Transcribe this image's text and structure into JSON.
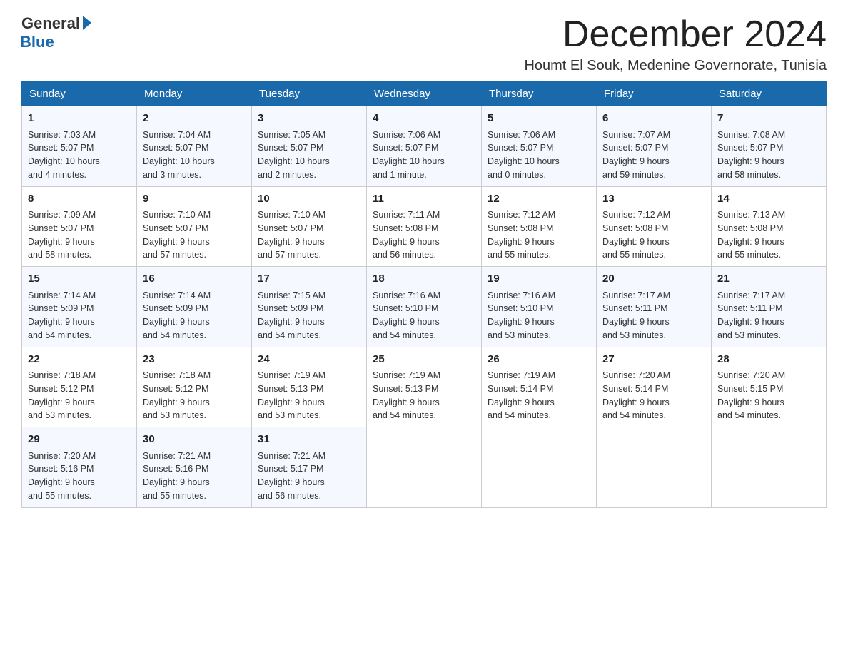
{
  "logo": {
    "general": "General",
    "blue": "Blue"
  },
  "header": {
    "month_year": "December 2024",
    "location": "Houmt El Souk, Medenine Governorate, Tunisia"
  },
  "columns": [
    "Sunday",
    "Monday",
    "Tuesday",
    "Wednesday",
    "Thursday",
    "Friday",
    "Saturday"
  ],
  "weeks": [
    [
      {
        "day": "1",
        "info": "Sunrise: 7:03 AM\nSunset: 5:07 PM\nDaylight: 10 hours\nand 4 minutes."
      },
      {
        "day": "2",
        "info": "Sunrise: 7:04 AM\nSunset: 5:07 PM\nDaylight: 10 hours\nand 3 minutes."
      },
      {
        "day": "3",
        "info": "Sunrise: 7:05 AM\nSunset: 5:07 PM\nDaylight: 10 hours\nand 2 minutes."
      },
      {
        "day": "4",
        "info": "Sunrise: 7:06 AM\nSunset: 5:07 PM\nDaylight: 10 hours\nand 1 minute."
      },
      {
        "day": "5",
        "info": "Sunrise: 7:06 AM\nSunset: 5:07 PM\nDaylight: 10 hours\nand 0 minutes."
      },
      {
        "day": "6",
        "info": "Sunrise: 7:07 AM\nSunset: 5:07 PM\nDaylight: 9 hours\nand 59 minutes."
      },
      {
        "day": "7",
        "info": "Sunrise: 7:08 AM\nSunset: 5:07 PM\nDaylight: 9 hours\nand 58 minutes."
      }
    ],
    [
      {
        "day": "8",
        "info": "Sunrise: 7:09 AM\nSunset: 5:07 PM\nDaylight: 9 hours\nand 58 minutes."
      },
      {
        "day": "9",
        "info": "Sunrise: 7:10 AM\nSunset: 5:07 PM\nDaylight: 9 hours\nand 57 minutes."
      },
      {
        "day": "10",
        "info": "Sunrise: 7:10 AM\nSunset: 5:07 PM\nDaylight: 9 hours\nand 57 minutes."
      },
      {
        "day": "11",
        "info": "Sunrise: 7:11 AM\nSunset: 5:08 PM\nDaylight: 9 hours\nand 56 minutes."
      },
      {
        "day": "12",
        "info": "Sunrise: 7:12 AM\nSunset: 5:08 PM\nDaylight: 9 hours\nand 55 minutes."
      },
      {
        "day": "13",
        "info": "Sunrise: 7:12 AM\nSunset: 5:08 PM\nDaylight: 9 hours\nand 55 minutes."
      },
      {
        "day": "14",
        "info": "Sunrise: 7:13 AM\nSunset: 5:08 PM\nDaylight: 9 hours\nand 55 minutes."
      }
    ],
    [
      {
        "day": "15",
        "info": "Sunrise: 7:14 AM\nSunset: 5:09 PM\nDaylight: 9 hours\nand 54 minutes."
      },
      {
        "day": "16",
        "info": "Sunrise: 7:14 AM\nSunset: 5:09 PM\nDaylight: 9 hours\nand 54 minutes."
      },
      {
        "day": "17",
        "info": "Sunrise: 7:15 AM\nSunset: 5:09 PM\nDaylight: 9 hours\nand 54 minutes."
      },
      {
        "day": "18",
        "info": "Sunrise: 7:16 AM\nSunset: 5:10 PM\nDaylight: 9 hours\nand 54 minutes."
      },
      {
        "day": "19",
        "info": "Sunrise: 7:16 AM\nSunset: 5:10 PM\nDaylight: 9 hours\nand 53 minutes."
      },
      {
        "day": "20",
        "info": "Sunrise: 7:17 AM\nSunset: 5:11 PM\nDaylight: 9 hours\nand 53 minutes."
      },
      {
        "day": "21",
        "info": "Sunrise: 7:17 AM\nSunset: 5:11 PM\nDaylight: 9 hours\nand 53 minutes."
      }
    ],
    [
      {
        "day": "22",
        "info": "Sunrise: 7:18 AM\nSunset: 5:12 PM\nDaylight: 9 hours\nand 53 minutes."
      },
      {
        "day": "23",
        "info": "Sunrise: 7:18 AM\nSunset: 5:12 PM\nDaylight: 9 hours\nand 53 minutes."
      },
      {
        "day": "24",
        "info": "Sunrise: 7:19 AM\nSunset: 5:13 PM\nDaylight: 9 hours\nand 53 minutes."
      },
      {
        "day": "25",
        "info": "Sunrise: 7:19 AM\nSunset: 5:13 PM\nDaylight: 9 hours\nand 54 minutes."
      },
      {
        "day": "26",
        "info": "Sunrise: 7:19 AM\nSunset: 5:14 PM\nDaylight: 9 hours\nand 54 minutes."
      },
      {
        "day": "27",
        "info": "Sunrise: 7:20 AM\nSunset: 5:14 PM\nDaylight: 9 hours\nand 54 minutes."
      },
      {
        "day": "28",
        "info": "Sunrise: 7:20 AM\nSunset: 5:15 PM\nDaylight: 9 hours\nand 54 minutes."
      }
    ],
    [
      {
        "day": "29",
        "info": "Sunrise: 7:20 AM\nSunset: 5:16 PM\nDaylight: 9 hours\nand 55 minutes."
      },
      {
        "day": "30",
        "info": "Sunrise: 7:21 AM\nSunset: 5:16 PM\nDaylight: 9 hours\nand 55 minutes."
      },
      {
        "day": "31",
        "info": "Sunrise: 7:21 AM\nSunset: 5:17 PM\nDaylight: 9 hours\nand 56 minutes."
      },
      {
        "day": "",
        "info": ""
      },
      {
        "day": "",
        "info": ""
      },
      {
        "day": "",
        "info": ""
      },
      {
        "day": "",
        "info": ""
      }
    ]
  ]
}
